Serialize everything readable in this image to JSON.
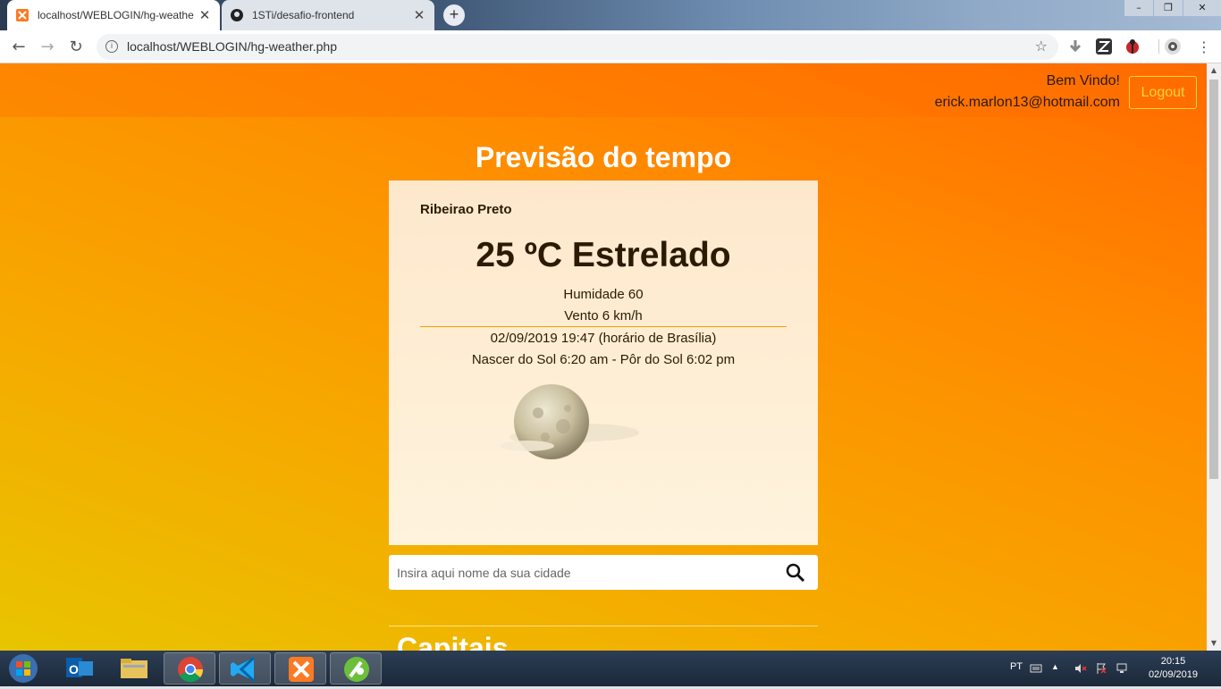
{
  "browser": {
    "tabs": [
      {
        "title": "localhost/WEBLOGIN/hg-weathe",
        "active": true
      },
      {
        "title": "1STi/desafio-frontend",
        "active": false
      }
    ],
    "url": "localhost/WEBLOGIN/hg-weather.php"
  },
  "header": {
    "welcome": "Bem Vindo!",
    "email": "erick.marlon13@hotmail.com",
    "logout_label": "Logout"
  },
  "main": {
    "title": "Previsão do tempo",
    "weather": {
      "city": "Ribeirao Preto",
      "temp_desc": "25 ºC Estrelado",
      "humidity": "Humidade 60",
      "wind": "Vento 6 km/h",
      "datetime": "02/09/2019 19:47 (horário de Brasília)",
      "sun": "Nascer do Sol 6:20 am - Pôr do Sol 6:02 pm",
      "icon": "moon-cloud-icon"
    },
    "search": {
      "placeholder": "Insira aqui nome da sua cidade"
    },
    "capitals_heading": "Capitais"
  },
  "taskbar": {
    "lang": "PT",
    "time": "20:15",
    "date": "02/09/2019"
  },
  "colors": {
    "accent": "#ffd23a",
    "page_gradient_top": "#ff6a00",
    "page_gradient_bottom": "#e8c400",
    "card_bg": "#fff0d5"
  }
}
